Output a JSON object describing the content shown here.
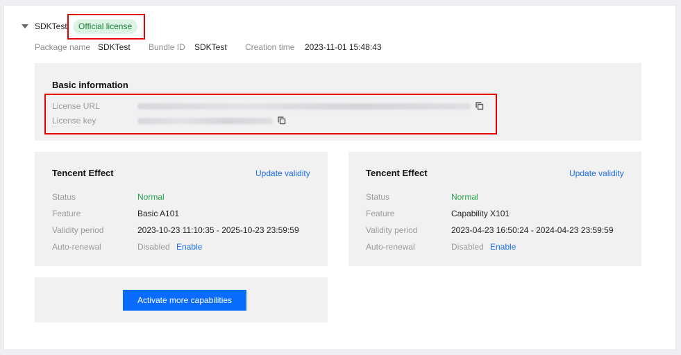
{
  "app": {
    "name": "SDKTest",
    "badge": "Official license",
    "meta": [
      {
        "label": "Package name",
        "value": "SDKTest"
      },
      {
        "label": "Bundle ID",
        "value": "SDKTest"
      },
      {
        "label": "Creation time",
        "value": "2023-11-01 15:48:43"
      }
    ]
  },
  "basic_info": {
    "title": "Basic information",
    "license_url_label": "License URL",
    "license_key_label": "License key",
    "copy_icon": "copy-icon"
  },
  "licenses": [
    {
      "title": "Tencent Effect",
      "update_label": "Update validity",
      "rows": {
        "status_label": "Status",
        "status_value": "Normal",
        "feature_label": "Feature",
        "feature_value": "Basic A101",
        "validity_label": "Validity period",
        "validity_value": "2023-10-23 11:10:35 - 2025-10-23 23:59:59",
        "renewal_label": "Auto-renewal",
        "renewal_value": "Disabled",
        "renewal_action": "Enable"
      }
    },
    {
      "title": "Tencent Effect",
      "update_label": "Update validity",
      "rows": {
        "status_label": "Status",
        "status_value": "Normal",
        "feature_label": "Feature",
        "feature_value": "Capability X101",
        "validity_label": "Validity period",
        "validity_value": "2023-04-23 16:50:24 - 2024-04-23 23:59:59",
        "renewal_label": "Auto-renewal",
        "renewal_value": "Disabled",
        "renewal_action": "Enable"
      }
    }
  ],
  "activate_button": "Activate more capabilities",
  "colors": {
    "accent": "#0a6cff",
    "status_ok": "#29a34a",
    "badge_bg": "#dcf4e3",
    "highlight": "#e60000"
  }
}
